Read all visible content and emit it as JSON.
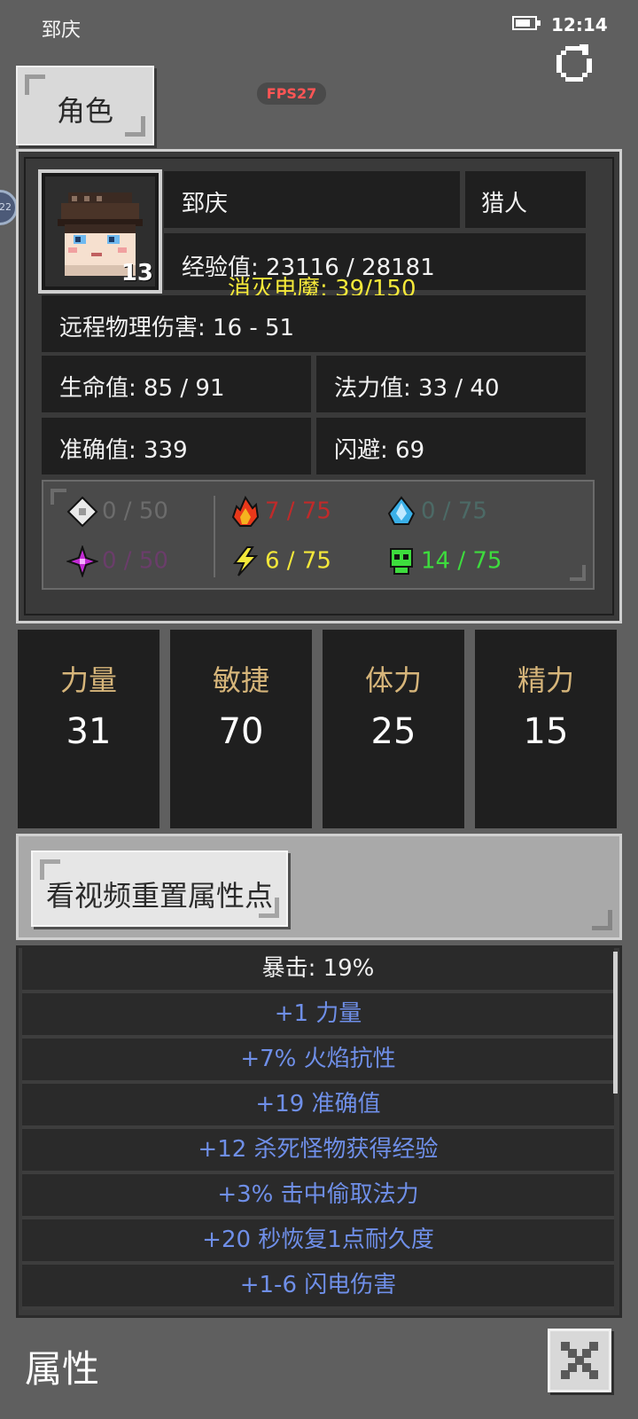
{
  "status_bar": {
    "title": "郅庆",
    "time": "12:14"
  },
  "fps_badge": "FPS27",
  "tab": {
    "label": "角色"
  },
  "side_badge": "22",
  "character": {
    "name": "郅庆",
    "class": "猎人",
    "level": "13",
    "experience": "经验值: 23116 / 28181",
    "quest": "消灭电魔: 39/150",
    "damage": "远程物理伤害: 16 - 51",
    "hp": "生命值: 85 / 91",
    "mp": "法力值: 33 / 40",
    "accuracy": "准确值: 339",
    "dodge": "闪避: 69"
  },
  "resistances": {
    "physical": {
      "text": "0 / 50",
      "color": "#6c6c6c",
      "icon": "shield-pixel-icon"
    },
    "fire": {
      "text": "7 / 75",
      "color": "#c02a2a",
      "icon": "fire-icon"
    },
    "cold": {
      "text": "0 / 75",
      "color": "#4c6a66",
      "icon": "ice-crystal-icon"
    },
    "magic": {
      "text": "0 / 50",
      "color": "#6a3d6a",
      "icon": "magic-star-icon"
    },
    "lightning": {
      "text": "6 / 75",
      "color": "#f4e83a",
      "icon": "lightning-icon"
    },
    "poison": {
      "text": "14 / 75",
      "color": "#3ddc3d",
      "icon": "skull-icon"
    }
  },
  "attributes": [
    {
      "name": "力量",
      "value": "31"
    },
    {
      "name": "敏捷",
      "value": "70"
    },
    {
      "name": "体力",
      "value": "25"
    },
    {
      "name": "精力",
      "value": "15"
    }
  ],
  "reset_button": "看视频重置属性点",
  "bonuses": [
    "暴击: 19%",
    "+1 力量",
    "+7% 火焰抗性",
    "+19 准确值",
    "+12 杀死怪物获得经验",
    "+3% 击中偷取法力",
    "+20 秒恢复1点耐久度",
    "+1-6 闪电伤害"
  ],
  "bottom_title": "属性"
}
